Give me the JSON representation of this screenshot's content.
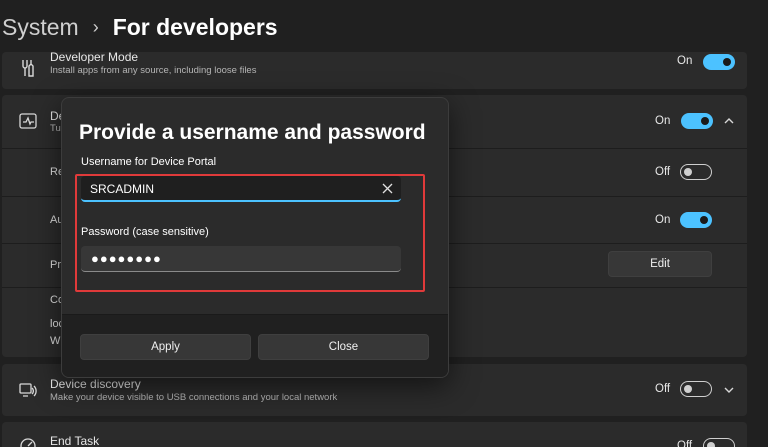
{
  "breadcrumb": {
    "parent": "System",
    "separator": "›",
    "current": "For developers"
  },
  "cards": {
    "developer_mode": {
      "title": "Developer Mode",
      "desc": "Install apps from any source, including loose files",
      "state": "On"
    },
    "device_portal": {
      "title_fragment": "De",
      "desc_fragment": "Tu",
      "state": "On"
    },
    "remote_row": {
      "label_fragment": "Re",
      "state": "Off"
    },
    "auth_row": {
      "label_fragment": "Au",
      "state": "On"
    },
    "port_row": {
      "label_fragment": "Pr",
      "edit_label": "Edit"
    },
    "conn_row": {
      "line1": "Co",
      "line2": "loc",
      "line3": "W"
    },
    "device_discovery": {
      "title": "Device discovery",
      "desc": "Make your device visible to USB connections and your local network",
      "state": "Off"
    },
    "end_task": {
      "title": "End Task",
      "state": "Off"
    }
  },
  "dialog": {
    "title": "Provide a username and password",
    "username_label": "Username for Device Portal",
    "username_value": "SRCADMIN",
    "password_label": "Password (case sensitive)",
    "password_value": "●●●●●●●●",
    "apply_label": "Apply",
    "close_label": "Close"
  },
  "colors": {
    "accent": "#4cc2ff",
    "highlight": "#e03a3a",
    "background": "#202020"
  }
}
